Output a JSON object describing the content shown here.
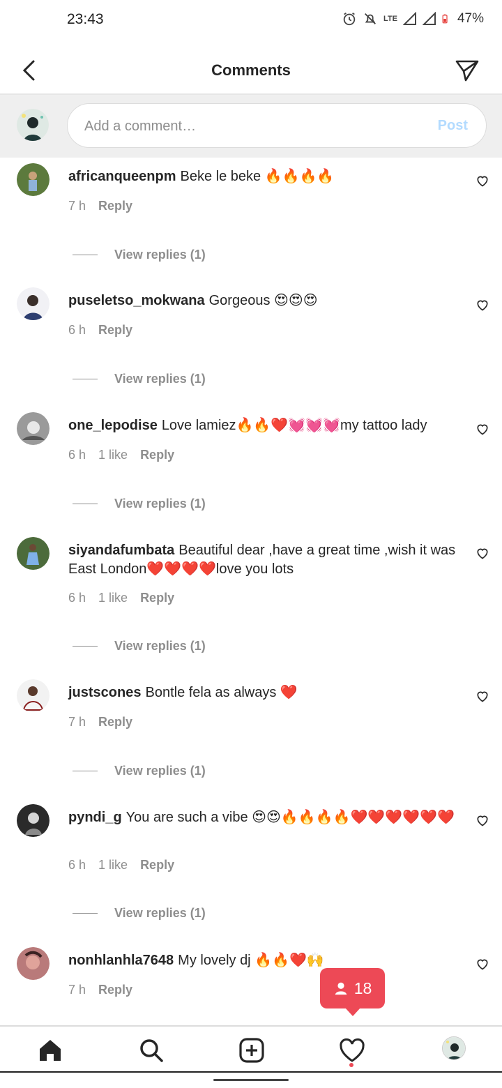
{
  "status": {
    "time": "23:43",
    "network": "LTE",
    "battery": "47%"
  },
  "header": {
    "title": "Comments"
  },
  "composer": {
    "placeholder": "Add a comment…",
    "post_label": "Post"
  },
  "comments": [
    {
      "username": "africanqueenpm",
      "text": "Beke le beke 🔥🔥🔥🔥",
      "time": "7 h",
      "likes": "",
      "reply_label": "Reply",
      "view_replies": "View replies (1)"
    },
    {
      "username": "puseletso_mokwana",
      "text": "Gorgeous 😍😍😍",
      "time": "6 h",
      "likes": "",
      "reply_label": "Reply",
      "view_replies": "View replies (1)"
    },
    {
      "username": "one_lepodise",
      "text": "Love lamiez🔥🔥❤️💓💓💓my tattoo lady",
      "time": "6 h",
      "likes": "1 like",
      "reply_label": "Reply",
      "view_replies": "View replies (1)"
    },
    {
      "username": "siyandafumbata",
      "text": "Beautiful dear ,have a great time ,wish it was East London❤️❤️❤️❤️love you lots",
      "time": "6 h",
      "likes": "1 like",
      "reply_label": "Reply",
      "view_replies": "View replies (1)"
    },
    {
      "username": "justscones",
      "text": "Bontle fela as always ❤️",
      "time": "7 h",
      "likes": "",
      "reply_label": "Reply",
      "view_replies": "View replies (1)"
    },
    {
      "username": "pyndi_g",
      "text": "You are such a vibe 😍😍🔥🔥🔥🔥❤️❤️❤️❤️❤️❤️",
      "time": "6 h",
      "likes": "1 like",
      "reply_label": "Reply",
      "view_replies": "View replies (1)"
    },
    {
      "username": "nonhlanhla7648",
      "text": "My lovely dj 🔥🔥❤️🙌",
      "time": "7 h",
      "likes": "",
      "reply_label": "Reply",
      "view_replies": ""
    }
  ],
  "toast": {
    "count": "18"
  },
  "tabbar": {
    "items": [
      "home-icon",
      "search-icon",
      "add-post-icon",
      "activity-heart-icon",
      "profile-avatar"
    ]
  },
  "colors": {
    "accent": "#ed4956",
    "post_disabled": "#b3dbff",
    "muted": "#8e8e8e"
  }
}
